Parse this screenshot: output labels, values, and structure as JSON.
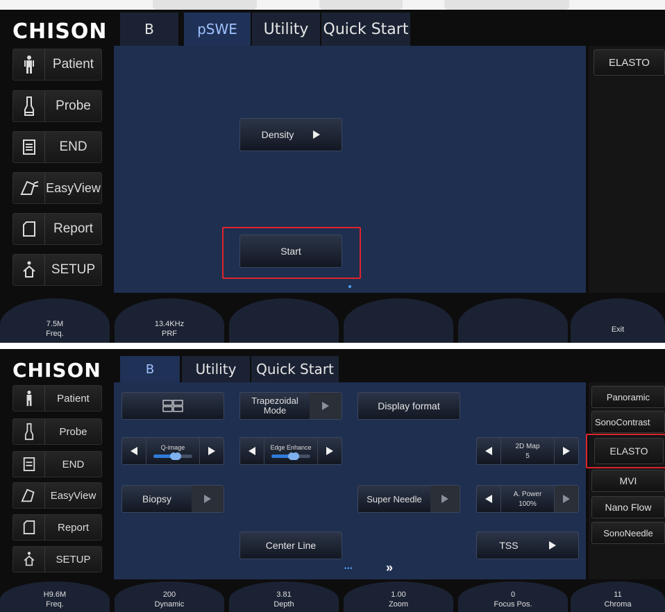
{
  "brand": "CHISON",
  "sidebar": {
    "items": [
      {
        "label": "Patient",
        "icon": "patient-icon"
      },
      {
        "label": "Probe",
        "icon": "probe-icon"
      },
      {
        "label": "END",
        "icon": "end-icon"
      },
      {
        "label": "EasyView",
        "icon": "easyview-icon"
      },
      {
        "label": "Report",
        "icon": "report-icon"
      },
      {
        "label": "SETUP",
        "icon": "setup-icon"
      }
    ]
  },
  "screen1": {
    "tabs": [
      {
        "label": "B",
        "active": false
      },
      {
        "label": "pSWE",
        "active": true
      },
      {
        "label": "Utility",
        "active": false
      },
      {
        "label": "Quick Start",
        "active": false
      }
    ],
    "density_label": "Density",
    "start_label": "Start",
    "right_panel": [
      "ELASTO"
    ],
    "knobs": [
      {
        "value": "7.5M",
        "label": "Freq."
      },
      {
        "value": "13.4KHz",
        "label": "PRF"
      },
      {
        "value": "",
        "label": ""
      },
      {
        "value": "",
        "label": ""
      },
      {
        "value": "",
        "label": ""
      },
      {
        "value": "",
        "label": "Exit"
      }
    ]
  },
  "screen2": {
    "tabs": [
      {
        "label": "B",
        "active": true
      },
      {
        "label": "Utility",
        "active": false
      },
      {
        "label": "Quick Start",
        "active": false
      }
    ],
    "controls": {
      "trapezoidal": "Trapezoidal Mode",
      "display_format": "Display format",
      "q_image": {
        "label": "Q-image",
        "value": "2",
        "level": 0.5
      },
      "edge_enhance": {
        "label": "Edge Enhance",
        "value": "2",
        "level": 0.5
      },
      "map_2d": {
        "label": "2D Map",
        "value": "5"
      },
      "biopsy": "Biopsy",
      "super_needle": "Super Needle",
      "a_power": {
        "label": "A. Power",
        "value": "100%"
      },
      "center_line": "Center Line",
      "tss": "TSS",
      "more_dots": "•••",
      "next_page": "»"
    },
    "right_panel": [
      "Panoramic",
      "SonoContrast",
      "ELASTO",
      "MVI",
      "Nano Flow",
      "SonoNeedle"
    ],
    "knobs": [
      {
        "value": "H9.6M",
        "label": "Freq."
      },
      {
        "value": "200",
        "label": "Dynamic"
      },
      {
        "value": "3.81",
        "label": "Depth"
      },
      {
        "value": "1.00",
        "label": "Zoom"
      },
      {
        "value": "0",
        "label": "Focus Pos."
      },
      {
        "value": "11",
        "label": "Chroma"
      }
    ]
  },
  "colors": {
    "highlight": "#e0242c",
    "content_bg": "#1f2f50",
    "active_tab": "#1f3156"
  }
}
